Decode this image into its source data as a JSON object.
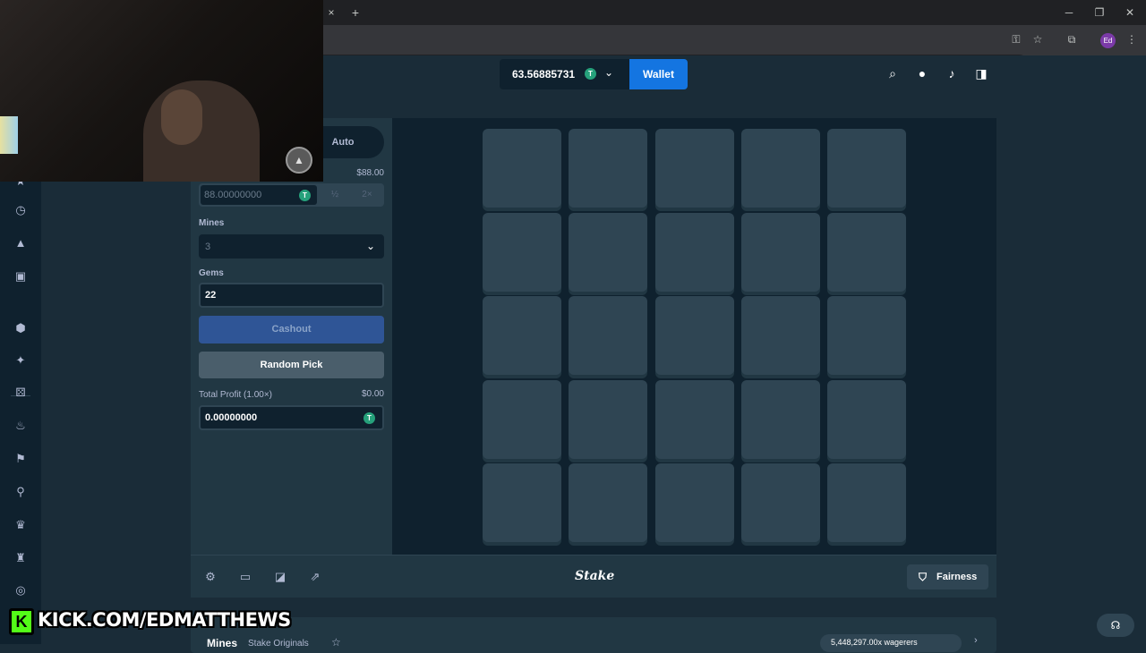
{
  "browser": {
    "tab_close": "×",
    "new_tab": "+",
    "win_min": "─",
    "win_max": "❐",
    "win_close": "✕",
    "profile_initials": "Ed"
  },
  "header": {
    "balance": "63.56885731",
    "currency_symbol": "T",
    "wallet_label": "Wallet"
  },
  "controls": {
    "mode_auto": "Auto",
    "bet_amount_usd": "$88.00",
    "bet_amount": "88.00000000",
    "half_label": "½",
    "double_label": "2×",
    "mines_label": "Mines",
    "mines_value": "3",
    "gems_label": "Gems",
    "gems_value": "22",
    "cashout_label": "Cashout",
    "random_pick_label": "Random Pick",
    "profit_label": "Total Profit (1.00×)",
    "profit_usd": "$0.00",
    "profit_value": "0.00000000"
  },
  "board": {
    "rows": 5,
    "cols": 5
  },
  "footer": {
    "logo": "Stake",
    "fairness_label": "Fairness"
  },
  "below": {
    "title": "Mines",
    "subtitle": "Stake Originals",
    "wagered": "5,448,297.00x wagerers"
  },
  "overlay": {
    "kick_letter": "K",
    "kick_url": "KICK.COM/EDMATTHEWS"
  },
  "colors": {
    "bg": "#1a2c38",
    "panel": "#213743",
    "tile": "#2f4553",
    "wallet": "#1475e1",
    "kick_green": "#53fc18"
  }
}
